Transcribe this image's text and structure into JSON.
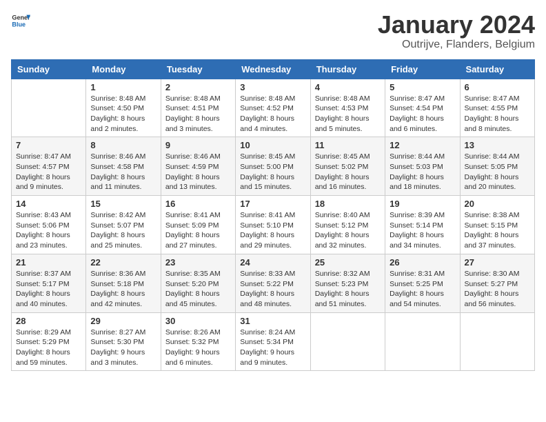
{
  "header": {
    "logo_general": "General",
    "logo_blue": "Blue",
    "title": "January 2024",
    "subtitle": "Outrijve, Flanders, Belgium"
  },
  "days_of_week": [
    "Sunday",
    "Monday",
    "Tuesday",
    "Wednesday",
    "Thursday",
    "Friday",
    "Saturday"
  ],
  "weeks": [
    [
      {
        "day": "",
        "sunrise": "",
        "sunset": "",
        "daylight": ""
      },
      {
        "day": "1",
        "sunrise": "Sunrise: 8:48 AM",
        "sunset": "Sunset: 4:50 PM",
        "daylight": "Daylight: 8 hours and 2 minutes."
      },
      {
        "day": "2",
        "sunrise": "Sunrise: 8:48 AM",
        "sunset": "Sunset: 4:51 PM",
        "daylight": "Daylight: 8 hours and 3 minutes."
      },
      {
        "day": "3",
        "sunrise": "Sunrise: 8:48 AM",
        "sunset": "Sunset: 4:52 PM",
        "daylight": "Daylight: 8 hours and 4 minutes."
      },
      {
        "day": "4",
        "sunrise": "Sunrise: 8:48 AM",
        "sunset": "Sunset: 4:53 PM",
        "daylight": "Daylight: 8 hours and 5 minutes."
      },
      {
        "day": "5",
        "sunrise": "Sunrise: 8:47 AM",
        "sunset": "Sunset: 4:54 PM",
        "daylight": "Daylight: 8 hours and 6 minutes."
      },
      {
        "day": "6",
        "sunrise": "Sunrise: 8:47 AM",
        "sunset": "Sunset: 4:55 PM",
        "daylight": "Daylight: 8 hours and 8 minutes."
      }
    ],
    [
      {
        "day": "7",
        "sunrise": "Sunrise: 8:47 AM",
        "sunset": "Sunset: 4:57 PM",
        "daylight": "Daylight: 8 hours and 9 minutes."
      },
      {
        "day": "8",
        "sunrise": "Sunrise: 8:46 AM",
        "sunset": "Sunset: 4:58 PM",
        "daylight": "Daylight: 8 hours and 11 minutes."
      },
      {
        "day": "9",
        "sunrise": "Sunrise: 8:46 AM",
        "sunset": "Sunset: 4:59 PM",
        "daylight": "Daylight: 8 hours and 13 minutes."
      },
      {
        "day": "10",
        "sunrise": "Sunrise: 8:45 AM",
        "sunset": "Sunset: 5:00 PM",
        "daylight": "Daylight: 8 hours and 15 minutes."
      },
      {
        "day": "11",
        "sunrise": "Sunrise: 8:45 AM",
        "sunset": "Sunset: 5:02 PM",
        "daylight": "Daylight: 8 hours and 16 minutes."
      },
      {
        "day": "12",
        "sunrise": "Sunrise: 8:44 AM",
        "sunset": "Sunset: 5:03 PM",
        "daylight": "Daylight: 8 hours and 18 minutes."
      },
      {
        "day": "13",
        "sunrise": "Sunrise: 8:44 AM",
        "sunset": "Sunset: 5:05 PM",
        "daylight": "Daylight: 8 hours and 20 minutes."
      }
    ],
    [
      {
        "day": "14",
        "sunrise": "Sunrise: 8:43 AM",
        "sunset": "Sunset: 5:06 PM",
        "daylight": "Daylight: 8 hours and 23 minutes."
      },
      {
        "day": "15",
        "sunrise": "Sunrise: 8:42 AM",
        "sunset": "Sunset: 5:07 PM",
        "daylight": "Daylight: 8 hours and 25 minutes."
      },
      {
        "day": "16",
        "sunrise": "Sunrise: 8:41 AM",
        "sunset": "Sunset: 5:09 PM",
        "daylight": "Daylight: 8 hours and 27 minutes."
      },
      {
        "day": "17",
        "sunrise": "Sunrise: 8:41 AM",
        "sunset": "Sunset: 5:10 PM",
        "daylight": "Daylight: 8 hours and 29 minutes."
      },
      {
        "day": "18",
        "sunrise": "Sunrise: 8:40 AM",
        "sunset": "Sunset: 5:12 PM",
        "daylight": "Daylight: 8 hours and 32 minutes."
      },
      {
        "day": "19",
        "sunrise": "Sunrise: 8:39 AM",
        "sunset": "Sunset: 5:14 PM",
        "daylight": "Daylight: 8 hours and 34 minutes."
      },
      {
        "day": "20",
        "sunrise": "Sunrise: 8:38 AM",
        "sunset": "Sunset: 5:15 PM",
        "daylight": "Daylight: 8 hours and 37 minutes."
      }
    ],
    [
      {
        "day": "21",
        "sunrise": "Sunrise: 8:37 AM",
        "sunset": "Sunset: 5:17 PM",
        "daylight": "Daylight: 8 hours and 40 minutes."
      },
      {
        "day": "22",
        "sunrise": "Sunrise: 8:36 AM",
        "sunset": "Sunset: 5:18 PM",
        "daylight": "Daylight: 8 hours and 42 minutes."
      },
      {
        "day": "23",
        "sunrise": "Sunrise: 8:35 AM",
        "sunset": "Sunset: 5:20 PM",
        "daylight": "Daylight: 8 hours and 45 minutes."
      },
      {
        "day": "24",
        "sunrise": "Sunrise: 8:33 AM",
        "sunset": "Sunset: 5:22 PM",
        "daylight": "Daylight: 8 hours and 48 minutes."
      },
      {
        "day": "25",
        "sunrise": "Sunrise: 8:32 AM",
        "sunset": "Sunset: 5:23 PM",
        "daylight": "Daylight: 8 hours and 51 minutes."
      },
      {
        "day": "26",
        "sunrise": "Sunrise: 8:31 AM",
        "sunset": "Sunset: 5:25 PM",
        "daylight": "Daylight: 8 hours and 54 minutes."
      },
      {
        "day": "27",
        "sunrise": "Sunrise: 8:30 AM",
        "sunset": "Sunset: 5:27 PM",
        "daylight": "Daylight: 8 hours and 56 minutes."
      }
    ],
    [
      {
        "day": "28",
        "sunrise": "Sunrise: 8:29 AM",
        "sunset": "Sunset: 5:29 PM",
        "daylight": "Daylight: 8 hours and 59 minutes."
      },
      {
        "day": "29",
        "sunrise": "Sunrise: 8:27 AM",
        "sunset": "Sunset: 5:30 PM",
        "daylight": "Daylight: 9 hours and 3 minutes."
      },
      {
        "day": "30",
        "sunrise": "Sunrise: 8:26 AM",
        "sunset": "Sunset: 5:32 PM",
        "daylight": "Daylight: 9 hours and 6 minutes."
      },
      {
        "day": "31",
        "sunrise": "Sunrise: 8:24 AM",
        "sunset": "Sunset: 5:34 PM",
        "daylight": "Daylight: 9 hours and 9 minutes."
      },
      {
        "day": "",
        "sunrise": "",
        "sunset": "",
        "daylight": ""
      },
      {
        "day": "",
        "sunrise": "",
        "sunset": "",
        "daylight": ""
      },
      {
        "day": "",
        "sunrise": "",
        "sunset": "",
        "daylight": ""
      }
    ]
  ]
}
